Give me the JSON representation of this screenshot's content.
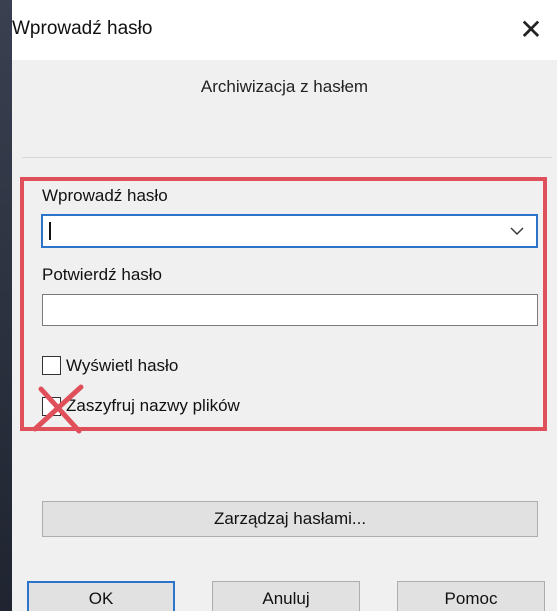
{
  "window": {
    "title": "Wprowadź hasło",
    "close_glyph": "✕"
  },
  "subtitle": "Archiwizacja z hasłem",
  "password": {
    "label": "Wprowadź hasło",
    "value": ""
  },
  "confirm": {
    "label": "Potwierdź hasło",
    "value": ""
  },
  "show_password": {
    "label": "Wyświetl hasło",
    "checked": false
  },
  "encrypt_names": {
    "label": "Zaszyfruj nazwy plików",
    "checked": false
  },
  "manage_button": "Zarządzaj hasłami...",
  "buttons": {
    "ok": "OK",
    "cancel": "Anuluj",
    "help": "Pomoc"
  },
  "colors": {
    "highlight_border": "#e0505a",
    "focus_blue": "#2b74c9",
    "cross_red": "#e0505a"
  },
  "icons": {
    "close": "close-icon",
    "dropdown": "chevron-down-icon",
    "annotation": "red-cross-mark-icon"
  }
}
